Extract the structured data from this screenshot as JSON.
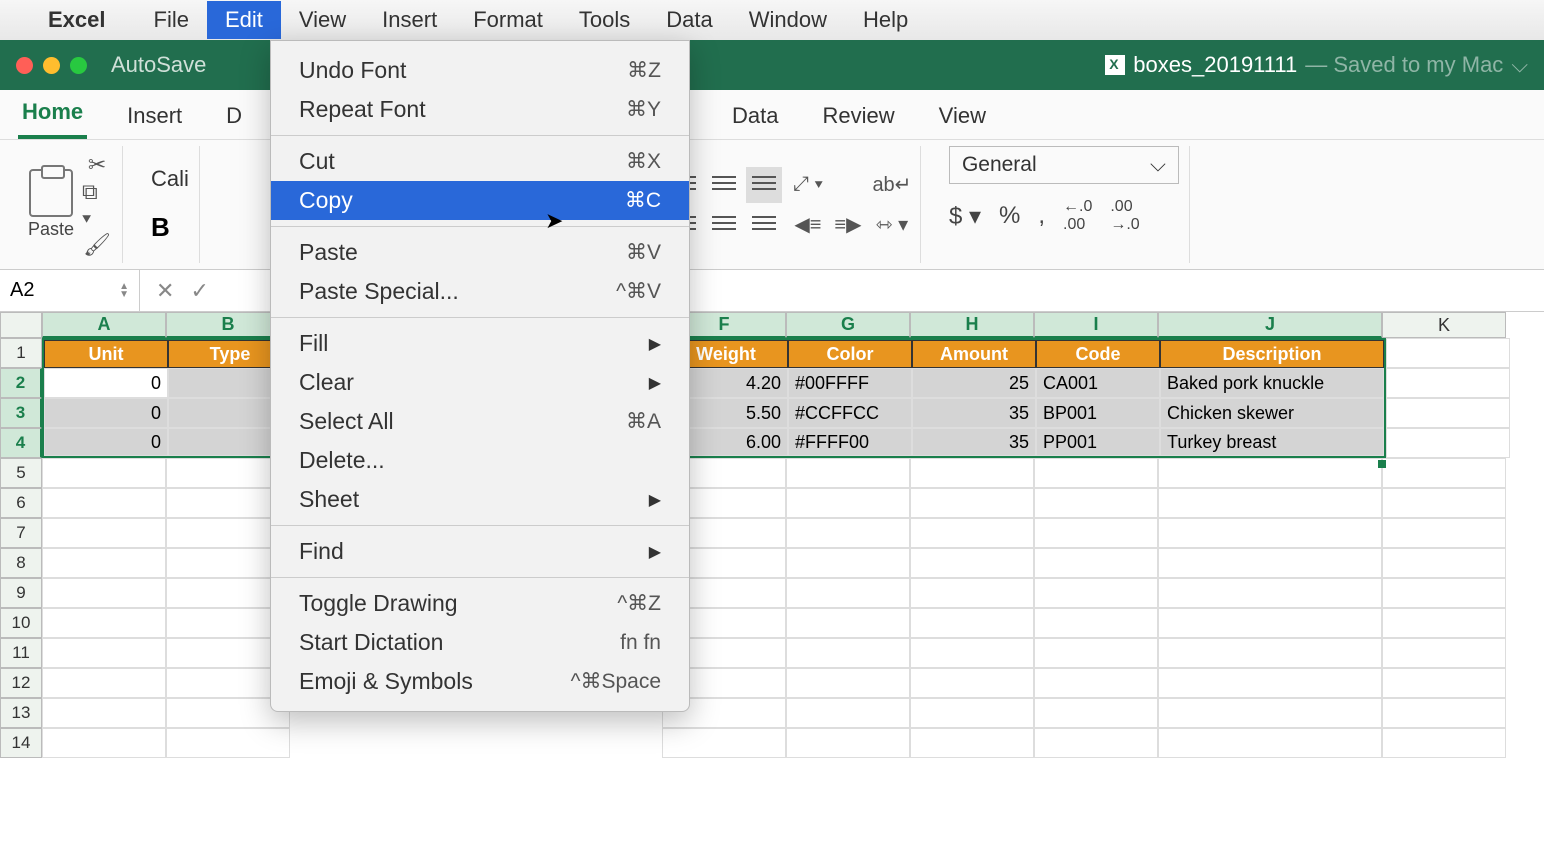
{
  "menubar": {
    "app": "Excel",
    "items": [
      "File",
      "Edit",
      "View",
      "Insert",
      "Format",
      "Tools",
      "Data",
      "Window",
      "Help"
    ],
    "active": "Edit"
  },
  "titlebar": {
    "autosave": "AutoSave",
    "filename": "boxes_20191111",
    "saved": "— Saved to my Mac"
  },
  "ribbon_tabs": [
    "Home",
    "Insert",
    "D",
    "Data",
    "Review",
    "View"
  ],
  "ribbon": {
    "paste": "Paste",
    "font_partial": "Cali",
    "bold": "B",
    "numfmt": "General"
  },
  "namebox": "A2",
  "columns": [
    "A",
    "B",
    "F",
    "G",
    "H",
    "I",
    "J",
    "K"
  ],
  "selected_cols": [
    "A",
    "B",
    "F",
    "G",
    "H",
    "I",
    "J"
  ],
  "headers": {
    "A": "Unit",
    "B": "Type",
    "F": "Weight",
    "G": "Color",
    "H": "Amount",
    "I": "Code",
    "J": "Description"
  },
  "rows": [
    {
      "r": "2",
      "A": "0",
      "F": "4.20",
      "G": "#00FFFF",
      "H": "25",
      "I": "CA001",
      "J": "Baked pork knuckle",
      "white": true
    },
    {
      "r": "3",
      "A": "0",
      "F": "5.50",
      "G": "#CCFFCC",
      "H": "35",
      "I": "BP001",
      "J": "Chicken skewer"
    },
    {
      "r": "4",
      "A": "0",
      "F": "6.00",
      "G": "#FFFF00",
      "H": "35",
      "I": "PP001",
      "J": "Turkey breast"
    }
  ],
  "emptyrows": [
    "5",
    "6",
    "7",
    "8",
    "9",
    "10",
    "11",
    "12",
    "13",
    "14"
  ],
  "dropdown": [
    {
      "t": "item",
      "label": "Undo Font",
      "sc": "⌘Z"
    },
    {
      "t": "item",
      "label": "Repeat Font",
      "sc": "⌘Y"
    },
    {
      "t": "sep"
    },
    {
      "t": "item",
      "label": "Cut",
      "sc": "⌘X"
    },
    {
      "t": "item",
      "label": "Copy",
      "sc": "⌘C",
      "hl": true
    },
    {
      "t": "sep"
    },
    {
      "t": "item",
      "label": "Paste",
      "sc": "⌘V"
    },
    {
      "t": "item",
      "label": "Paste Special...",
      "sc": "^⌘V"
    },
    {
      "t": "sep"
    },
    {
      "t": "item",
      "label": "Fill",
      "sub": true
    },
    {
      "t": "item",
      "label": "Clear",
      "sub": true
    },
    {
      "t": "item",
      "label": "Select All",
      "sc": "⌘A"
    },
    {
      "t": "item",
      "label": "Delete..."
    },
    {
      "t": "item",
      "label": "Sheet",
      "sub": true
    },
    {
      "t": "sep"
    },
    {
      "t": "item",
      "label": "Find",
      "sub": true
    },
    {
      "t": "sep"
    },
    {
      "t": "item",
      "label": "Toggle Drawing",
      "sc": "^⌘Z"
    },
    {
      "t": "item",
      "label": "Start Dictation",
      "sc": "fn fn"
    },
    {
      "t": "item",
      "label": "Emoji & Symbols",
      "sc": "^⌘Space"
    }
  ]
}
